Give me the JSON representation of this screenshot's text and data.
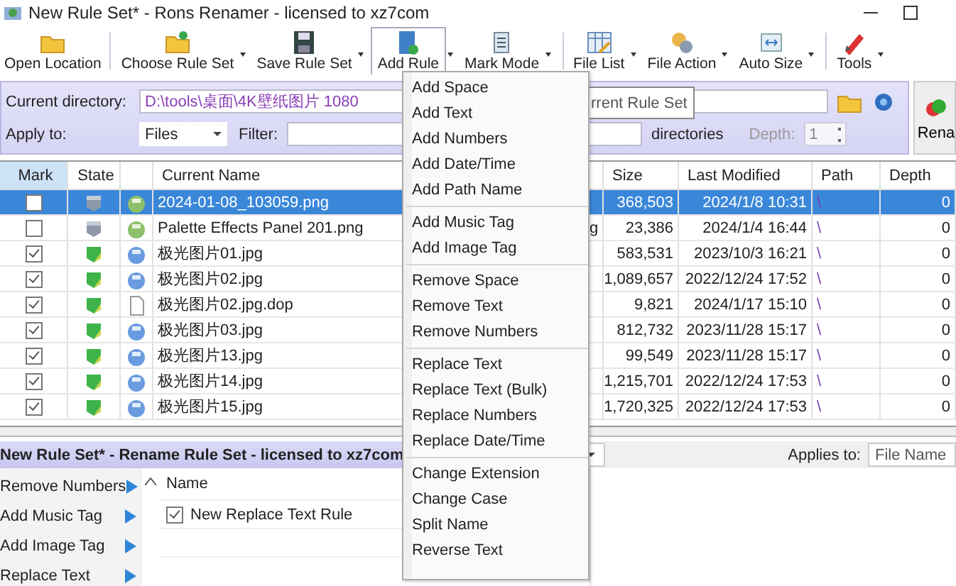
{
  "window": {
    "title": "New Rule Set* - Rons Renamer - licensed to xz7com"
  },
  "toolbar": [
    {
      "label": "Open Location",
      "dropdown": false,
      "pressed": false,
      "separator_after": true
    },
    {
      "label": "Choose Rule Set",
      "dropdown": true,
      "pressed": false,
      "separator_after": false
    },
    {
      "label": "Save Rule Set",
      "dropdown": true,
      "pressed": false,
      "separator_after": false
    },
    {
      "label": "Add Rule",
      "dropdown": true,
      "pressed": true,
      "separator_after": false
    },
    {
      "label": "Mark Mode",
      "dropdown": true,
      "pressed": false,
      "separator_after": true
    },
    {
      "label": "File List",
      "dropdown": true,
      "pressed": false,
      "separator_after": false
    },
    {
      "label": "File Action",
      "dropdown": true,
      "pressed": false,
      "separator_after": false
    },
    {
      "label": "Auto Size",
      "dropdown": true,
      "pressed": false,
      "separator_after": true
    },
    {
      "label": "Tools",
      "dropdown": true,
      "pressed": false,
      "separator_after": false
    }
  ],
  "directory": {
    "label": "Current directory:",
    "value": "D:\\tools\\桌面\\4K壁纸图片 1080"
  },
  "apply_to": {
    "label": "Apply to:",
    "value": "Files"
  },
  "filter": {
    "label": "Filter:"
  },
  "include_sub": {
    "label": "directories"
  },
  "depth": {
    "label": "Depth:",
    "value": "1"
  },
  "tooltip": "rrent Rule Set",
  "rename_button": "Rena",
  "file_table": {
    "columns": [
      "Mark",
      "State",
      "Current Name",
      "Size",
      "Last Modified",
      "Path",
      "Depth"
    ],
    "rows": [
      {
        "selected": true,
        "marked": false,
        "ready": false,
        "kind": "png",
        "name": "2024-01-08_103059.png",
        "size": "368,503",
        "modified": "2024/1/8 10:31",
        "path": "\\",
        "depth": "0"
      },
      {
        "selected": false,
        "marked": false,
        "ready": false,
        "kind": "png",
        "name": "Palette Effects Panel 201.png",
        "column_5": "g",
        "size": "23,386",
        "modified": "2024/1/4 16:44",
        "path": "\\",
        "depth": "0"
      },
      {
        "selected": false,
        "marked": true,
        "ready": true,
        "kind": "jpg",
        "name": "极光图片01.jpg",
        "size": "583,531",
        "modified": "2023/10/3 16:21",
        "path": "\\",
        "depth": "0"
      },
      {
        "selected": false,
        "marked": true,
        "ready": true,
        "kind": "jpg",
        "name": "极光图片02.jpg",
        "size": "1,089,657",
        "modified": "2022/12/24 17:52",
        "path": "\\",
        "depth": "0"
      },
      {
        "selected": false,
        "marked": true,
        "ready": true,
        "kind": "doc",
        "name": "极光图片02.jpg.dop",
        "size": "9,821",
        "modified": "2024/1/17 15:10",
        "path": "\\",
        "depth": "0"
      },
      {
        "selected": false,
        "marked": true,
        "ready": true,
        "kind": "jpg",
        "name": "极光图片03.jpg",
        "size": "812,732",
        "modified": "2023/11/28 15:17",
        "path": "\\",
        "depth": "0"
      },
      {
        "selected": false,
        "marked": true,
        "ready": true,
        "kind": "jpg",
        "name": "极光图片13.jpg",
        "size": "99,549",
        "modified": "2023/11/28 15:17",
        "path": "\\",
        "depth": "0"
      },
      {
        "selected": false,
        "marked": true,
        "ready": true,
        "kind": "jpg",
        "name": "极光图片14.jpg",
        "size": "1,215,701",
        "modified": "2022/12/24 17:53",
        "path": "\\",
        "depth": "0"
      },
      {
        "selected": false,
        "marked": true,
        "ready": true,
        "kind": "jpg",
        "name": "极光图片15.jpg",
        "size": "1,720,325",
        "modified": "2022/12/24 17:53",
        "path": "\\",
        "depth": "0"
      }
    ]
  },
  "rule_panel": {
    "title": "New Rule Set* - Rename Rule Set - licensed to xz7com",
    "applies_to": {
      "label": "Applies to:",
      "value": "File Name"
    },
    "rule_types": [
      {
        "label": "Remove Numbers"
      },
      {
        "label": "Add Music Tag"
      },
      {
        "label": "Add Image Tag"
      },
      {
        "label": "Replace Text"
      }
    ],
    "rules": {
      "columns": [
        "Name"
      ],
      "rows": [
        {
          "name": "New Replace Text Rule",
          "checked": true
        }
      ]
    }
  },
  "add_rule_menu": {
    "sections": [
      {
        "items": [
          "Add Space",
          "Add Text",
          "Add Numbers",
          "Add Date/Time",
          "Add Path Name"
        ]
      },
      {
        "items": [
          "Add Music Tag",
          "Add Image Tag"
        ]
      },
      {
        "items": [
          "Remove Space",
          "Remove Text",
          "Remove Numbers"
        ]
      },
      {
        "items": [
          "Replace Text",
          "Replace Text (Bulk)",
          "Replace Numbers",
          "Replace Date/Time"
        ]
      },
      {
        "items": [
          "Change Extension",
          "Change Case",
          "Split Name",
          "Reverse Text"
        ]
      }
    ]
  }
}
